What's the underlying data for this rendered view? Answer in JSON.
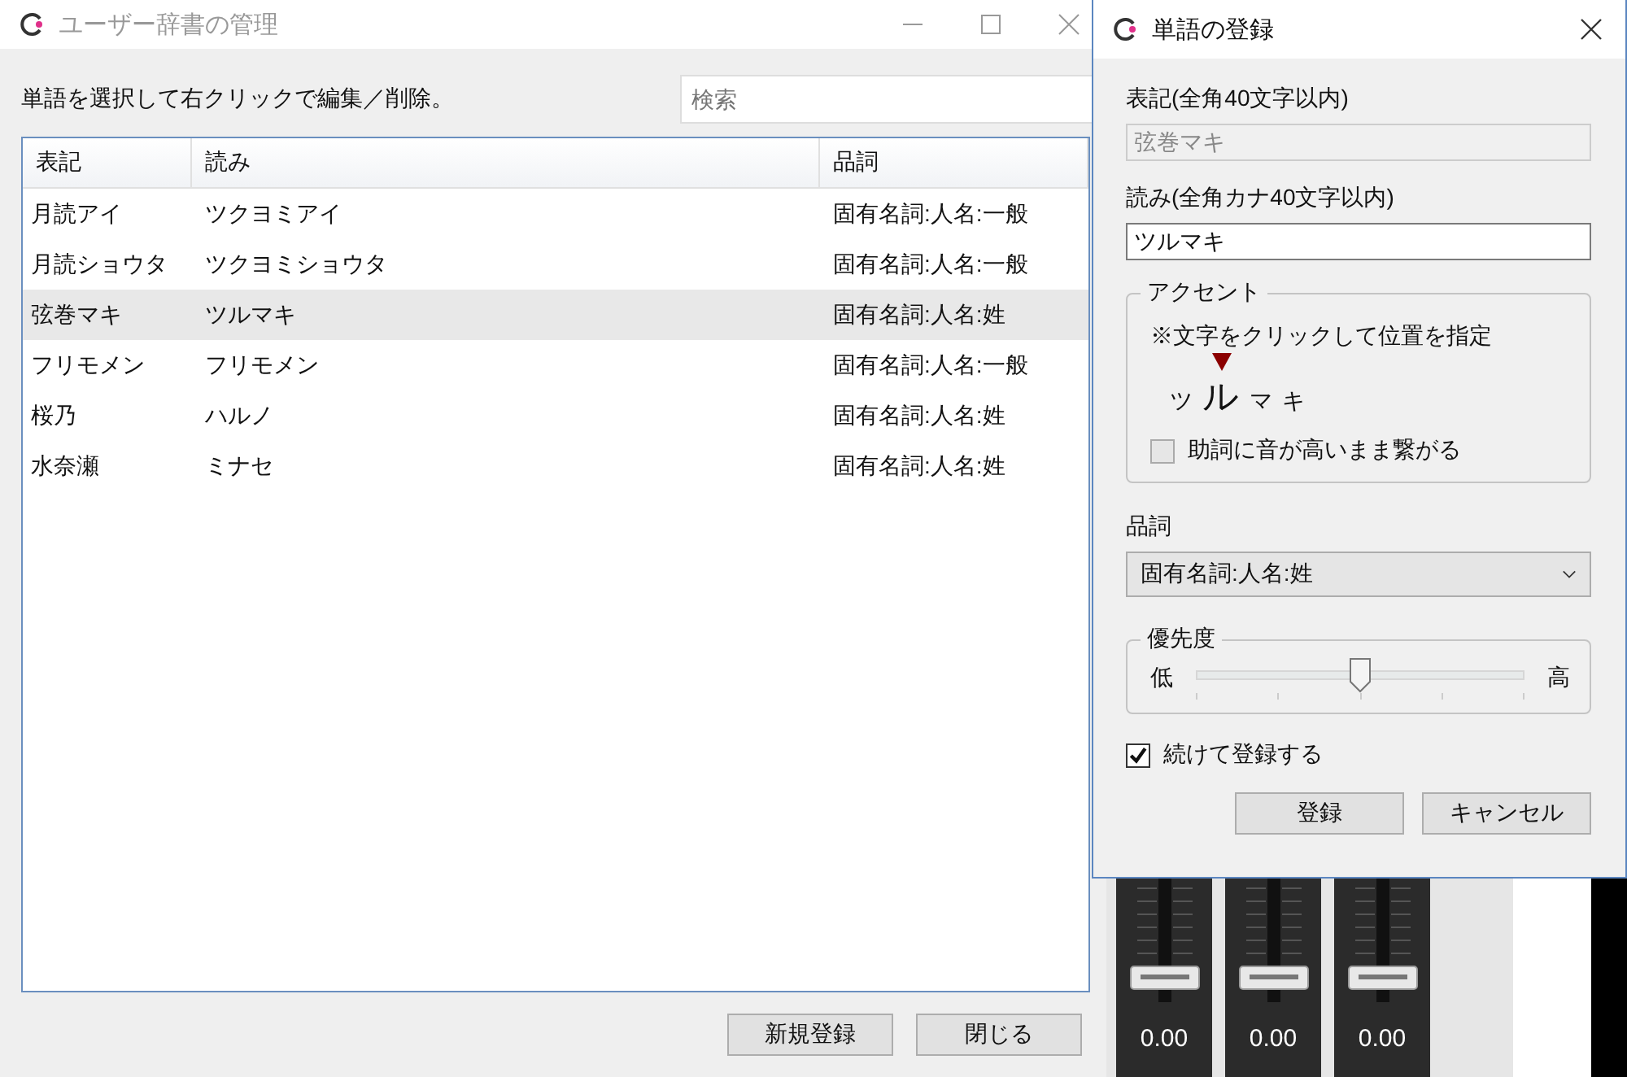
{
  "main_window": {
    "title": "ユーザー辞書の管理",
    "instruction": "単語を選択して右クリックで編集／削除。",
    "search": {
      "placeholder": "検索"
    },
    "table": {
      "columns": [
        "表記",
        "読み",
        "品詞"
      ],
      "rows": [
        {
          "cells": [
            "月読アイ",
            "ツクヨミアイ",
            "固有名詞:人名:一般"
          ],
          "selected": false
        },
        {
          "cells": [
            "月読ショウタ",
            "ツクヨミショウタ",
            "固有名詞:人名:一般"
          ],
          "selected": false
        },
        {
          "cells": [
            "弦巻マキ",
            "ツルマキ",
            "固有名詞:人名:姓"
          ],
          "selected": true
        },
        {
          "cells": [
            "フリモメン",
            "フリモメン",
            "固有名詞:人名:一般"
          ],
          "selected": false
        },
        {
          "cells": [
            "桜乃",
            "ハルノ",
            "固有名詞:人名:姓"
          ],
          "selected": false
        },
        {
          "cells": [
            "水奈瀬",
            "ミナセ",
            "固有名詞:人名:姓"
          ],
          "selected": false
        }
      ]
    },
    "buttons": [
      "新規登録",
      "閉じる"
    ]
  },
  "dialog": {
    "title": "単語の登録",
    "surface": {
      "label": "表記(全角40文字以内)",
      "value": "弦巻マキ",
      "disabled": true
    },
    "reading": {
      "label": "読み(全角カナ40文字以内)",
      "value": "ツルマキ",
      "disabled": false
    },
    "accent": {
      "legend": "アクセント",
      "note": "※文字をクリックして位置を指定",
      "morae": [
        {
          "text": "ツ",
          "selected": false
        },
        {
          "text": "ル",
          "selected": true
        },
        {
          "text": "マ",
          "selected": false
        },
        {
          "text": "キ",
          "selected": false
        }
      ],
      "connect": {
        "label": "助詞に音が高いまま繋がる",
        "checked": false
      }
    },
    "part_of_speech": {
      "label": "品詞",
      "value": "固有名詞:人名:姓"
    },
    "priority": {
      "legend": "優先度",
      "low": "低",
      "high": "高",
      "level": 0.5
    },
    "continue": {
      "label": "続けて登録する",
      "checked": true
    },
    "buttons": [
      "登録",
      "キャンセル"
    ]
  },
  "mixer": {
    "channels": [
      {
        "reading": "0.00"
      },
      {
        "reading": "0.00"
      },
      {
        "reading": "0.00"
      }
    ]
  }
}
